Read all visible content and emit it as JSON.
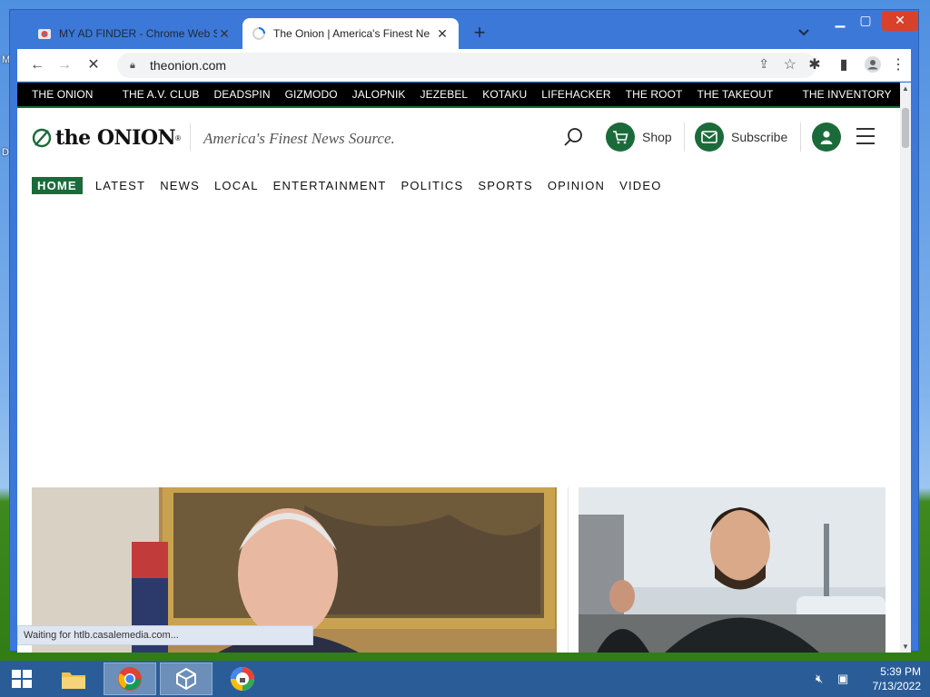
{
  "browser": {
    "tabs": [
      {
        "title": "MY AD FINDER - Chrome Web St",
        "active": false
      },
      {
        "title": "The Onion | America's Finest Ne",
        "active": true
      }
    ],
    "new_tab_label": "+",
    "url": "theonion.com",
    "status_text": "Waiting for htlb.casalemedia.com..."
  },
  "site": {
    "network_links": [
      "THE ONION",
      "THE A.V. CLUB",
      "DEADSPIN",
      "GIZMODO",
      "JALOPNIK",
      "JEZEBEL",
      "KOTAKU",
      "LIFEHACKER",
      "THE ROOT",
      "THE TAKEOUT",
      "THE INVENTORY"
    ],
    "logo_text": "the ONION",
    "logo_mark": "®",
    "tagline": "America's Finest News Source.",
    "shop_label": "Shop",
    "subscribe_label": "Subscribe",
    "sections": [
      "HOME",
      "LATEST",
      "NEWS",
      "LOCAL",
      "ENTERTAINMENT",
      "POLITICS",
      "SPORTS",
      "OPINION",
      "VIDEO"
    ],
    "accent_color": "#1b6b3a"
  },
  "taskbar": {
    "time": "5:39 PM",
    "date": "7/13/2022"
  }
}
